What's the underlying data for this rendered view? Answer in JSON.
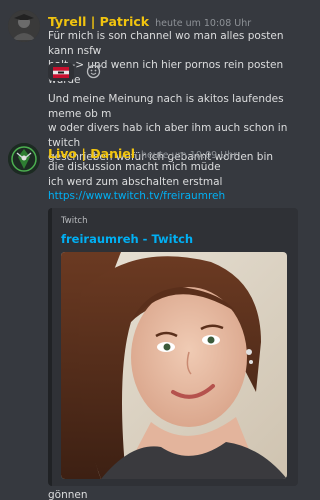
{
  "messages": [
    {
      "author": "Tyrell | Patrick",
      "timestamp": "heute um 10:08 Uhr",
      "lines": [
        "Für mich is son channel wo man alles posten kann nsfw",
        "halt -> und wenn ich hier pornos rein posten würde"
      ],
      "reaction": {
        "icon": "flag-icon",
        "count": ""
      },
      "follow_up_lines": [
        "Und meine Meinung nach is akitos laufendes meme ob m",
        "w oder divers hab ich aber ihm auch schon in twitch",
        "geschrieben wofür ich gebannt worden bin"
      ]
    },
    {
      "author": "Livo | Daniel",
      "timestamp": "heute um 10:09 Uhr",
      "lines": [
        "die diskussion macht mich müde",
        "ich werd zum abschalten erstmal"
      ],
      "link": "https://www.twitch.tv/freiraumreh",
      "embed": {
        "provider": "Twitch",
        "title": "freiraumreh - Twitch"
      }
    }
  ],
  "last_message": "gönnen",
  "colors": {
    "background": "#36393f",
    "author": "#f1c40f",
    "link": "#00b0f4",
    "embed_background": "#2f3136",
    "timestamp": "#8e9297"
  }
}
